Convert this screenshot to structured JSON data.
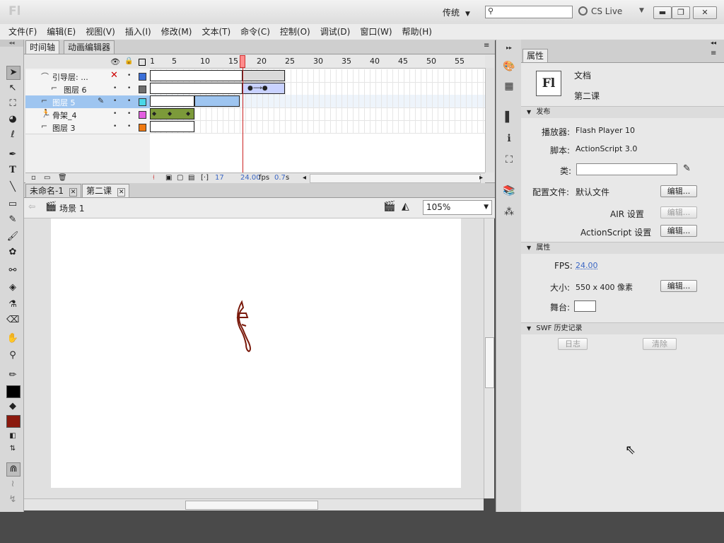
{
  "app": {
    "logo": "Fl",
    "workspace": "传统",
    "search_placeholder": "",
    "cs_live": "CS Live"
  },
  "menu": [
    "文件(F)",
    "编辑(E)",
    "视图(V)",
    "插入(I)",
    "修改(M)",
    "文本(T)",
    "命令(C)",
    "控制(O)",
    "调试(D)",
    "窗口(W)",
    "帮助(H)"
  ],
  "timeline": {
    "tabs": [
      "时间轴",
      "动画编辑器"
    ],
    "ruler": [
      "1",
      "5",
      "10",
      "15",
      "20",
      "25",
      "30",
      "35",
      "40",
      "45",
      "50",
      "55"
    ],
    "layers": [
      {
        "name": "引导层: ...",
        "color": "#3b6fd8"
      },
      {
        "name": "图层 6",
        "color": "#6e6e6e"
      },
      {
        "name": "图层 5",
        "color": "#49d7e8"
      },
      {
        "name": "骨架_4",
        "color": "#e35ee0"
      },
      {
        "name": "图层 3",
        "color": "#f07a12"
      }
    ],
    "current_frame": "17",
    "fps": "24.00",
    "fps_unit": "fps",
    "elapsed": "0.7",
    "elapsed_unit": "s"
  },
  "doc_tabs": [
    "未命名-1",
    "第二课"
  ],
  "editbar": {
    "scene": "场景 1",
    "zoom": "105%"
  },
  "properties": {
    "tab": "属性",
    "doc_icon": "Fl",
    "doc_type": "文档",
    "doc_name": "第二课",
    "publish_header": "发布",
    "player_label": "播放器:",
    "player_value": "Flash Player 10",
    "script_label": "脚本:",
    "script_value": "ActionScript 3.0",
    "class_label": "类:",
    "profile_label": "配置文件:",
    "profile_value": "默认文件",
    "edit": "编辑...",
    "air_label": "AIR 设置",
    "as_label": "ActionScript 设置",
    "props_header": "属性",
    "fps_label": "FPS:",
    "fps_value": "24.00",
    "size_label": "大小:",
    "size_value": "550 x 400 像素",
    "stage_label": "舞台:",
    "stage_color": "#ffffff",
    "history_header": "SWF 历史记录",
    "log_button": "日志",
    "clear_button": "清除"
  }
}
